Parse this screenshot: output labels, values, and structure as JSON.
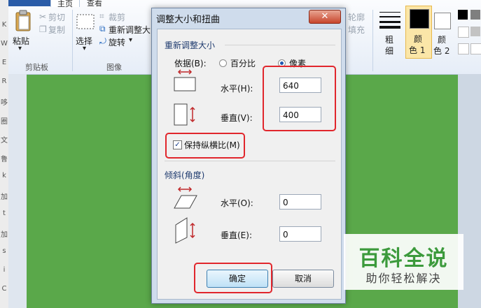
{
  "left_strip": [
    "K",
    "W",
    "E",
    "R",
    "哆",
    "圈",
    "文",
    "鲁",
    "k",
    "加",
    "t",
    "加",
    "s",
    "i",
    "C"
  ],
  "ribbon": {
    "tabs": [
      "主页",
      "查看"
    ],
    "clipboard": {
      "paste": "粘贴",
      "cut": "剪切",
      "copy": "复制",
      "group": "剪贴板"
    },
    "image": {
      "select": "选择",
      "crop": "裁剪",
      "resize": "重新调整大",
      "rotate": "旋转",
      "group": "图像"
    },
    "shapes": {
      "outline": "轮廓",
      "fill": "填充"
    },
    "size": "粗\n细",
    "size_top": "粗",
    "size_bottom": "细",
    "color1_top": "颜",
    "color1_bottom": "色 1",
    "color2_top": "颜",
    "color2_bottom": "色 2"
  },
  "dialog": {
    "title": "调整大小和扭曲",
    "close": "✕",
    "resize": {
      "legend": "重新调整大小",
      "by_label": "依据(B):",
      "percent": "百分比",
      "pixels": "像素",
      "selected": "pixels",
      "horizontal_label": "水平(H):",
      "horizontal_value": "640",
      "vertical_label": "垂直(V):",
      "vertical_value": "400",
      "keep_ratio_label": "保持纵横比(M)",
      "keep_ratio_checked": true
    },
    "skew": {
      "legend": "倾斜(角度)",
      "horizontal_label": "水平(O):",
      "horizontal_value": "0",
      "vertical_label": "垂直(E):",
      "vertical_value": "0"
    },
    "ok": "确定",
    "cancel": "取消"
  },
  "watermark": {
    "main": "百科全说",
    "sub": "助你轻松解决"
  },
  "colors": {
    "highlight": "#e1262c",
    "canvas": "#5aa84a",
    "selected_color": "#f7c84e"
  }
}
